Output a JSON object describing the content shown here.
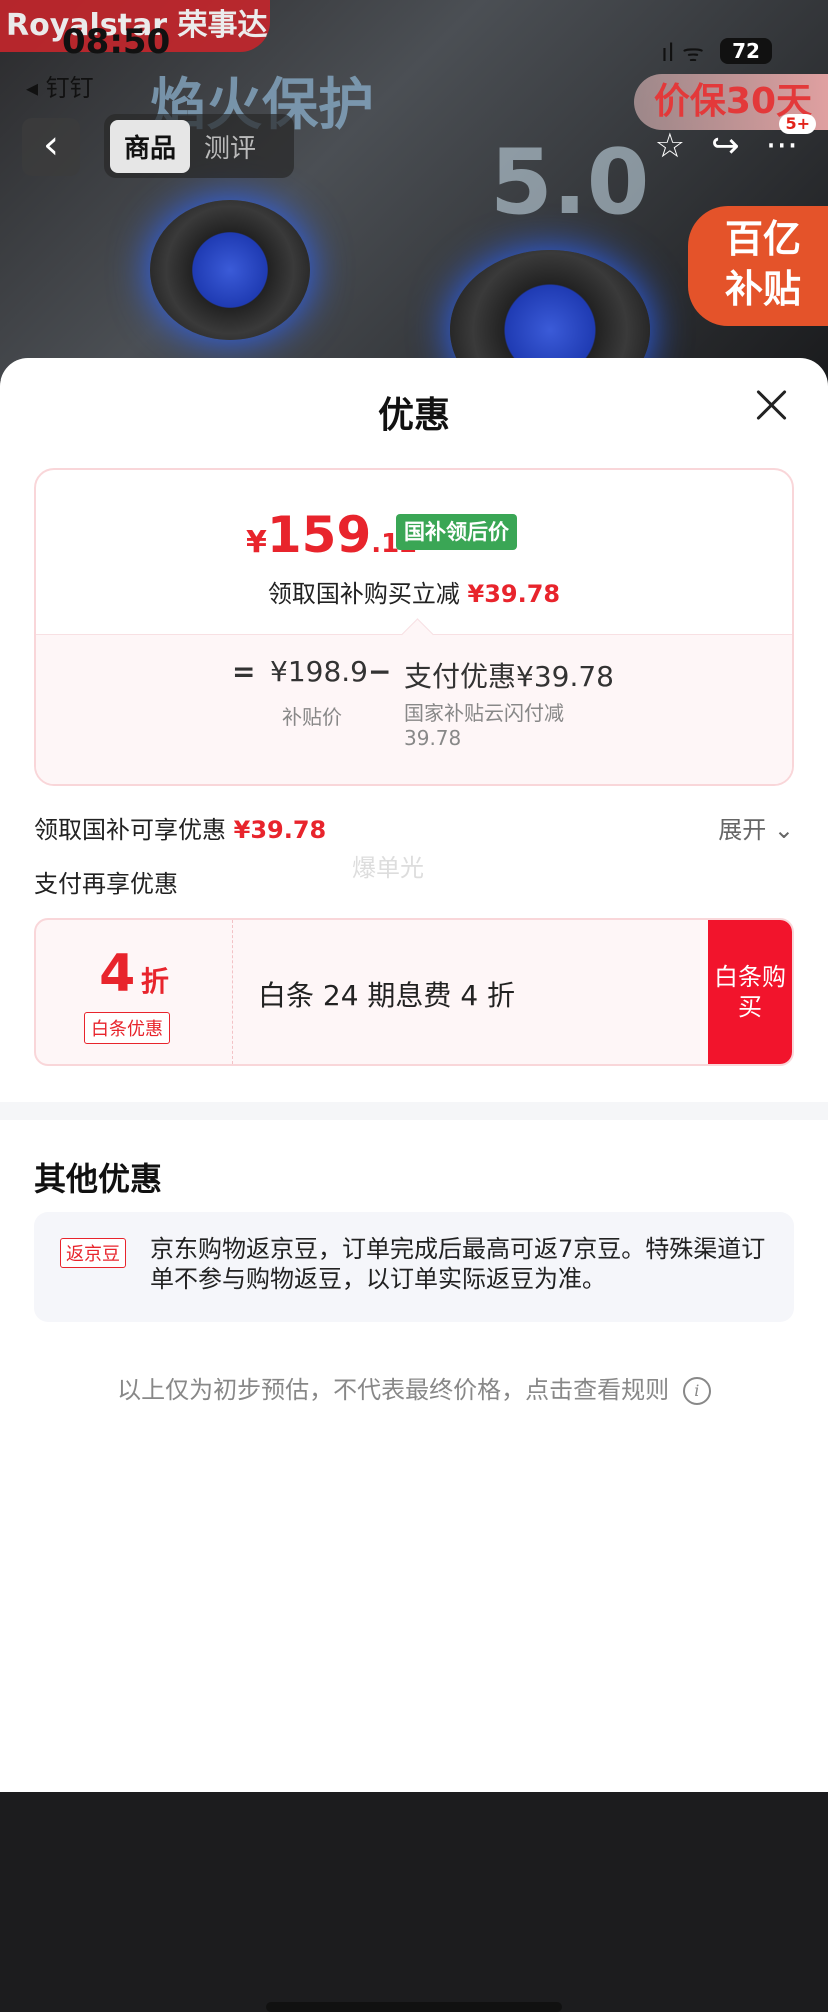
{
  "status_bar": {
    "time": "08:50",
    "back_app": "◂ 钉钉",
    "battery": "72",
    "signal": "ıl ᯤ"
  },
  "background": {
    "brand_text": "Royalstar 荣事达",
    "promo_left": "焰火保护",
    "promo_mid": "5.0",
    "price_protect": "价保30天",
    "subsidy_badge_line1": "百亿",
    "subsidy_badge_line2": "补贴"
  },
  "nav": {
    "back_glyph": "‹",
    "tabs": [
      {
        "label": "商品",
        "active": true
      },
      {
        "label": "测评",
        "active": false
      }
    ],
    "star_glyph": "☆",
    "share_glyph": "↪",
    "more_glyph": "···",
    "more_badge": "5+"
  },
  "sheet": {
    "title": "优惠",
    "price_card": {
      "currency": "¥",
      "price_int": "159",
      "price_dec": ".12",
      "tag": "国补领后价",
      "claim_text": "领取国补购买立减",
      "claim_amount": "¥39.78",
      "eq": "=",
      "subsidy_price": "¥198.9",
      "minus": "−",
      "pay_discount": "支付优惠¥39.78",
      "subsidy_price_label": "补贴价",
      "pay_discount_detail": "国家补贴云闪付减39.78"
    },
    "enjoy_text": "领取国补可享优惠",
    "enjoy_amount": "¥39.78",
    "expand": "展开 ⌄",
    "pay_again": "支付再享优惠",
    "watermark": "爆单光",
    "baitiao": {
      "discount_num": "4",
      "discount_unit": "折",
      "label": "白条优惠",
      "desc": "白条 24 期息费 4 折",
      "buy": "白条购买"
    },
    "other_title": "其他优惠",
    "other_card": {
      "tag": "返京豆",
      "text": "京东购物返京豆，订单完成后最高可返7京豆。特殊渠道订单不参与购物返豆，以订单实际返豆为准。"
    },
    "footnote": "以上仅为初步预估，不代表最终价格，点击查看规则",
    "info_glyph": "i"
  }
}
